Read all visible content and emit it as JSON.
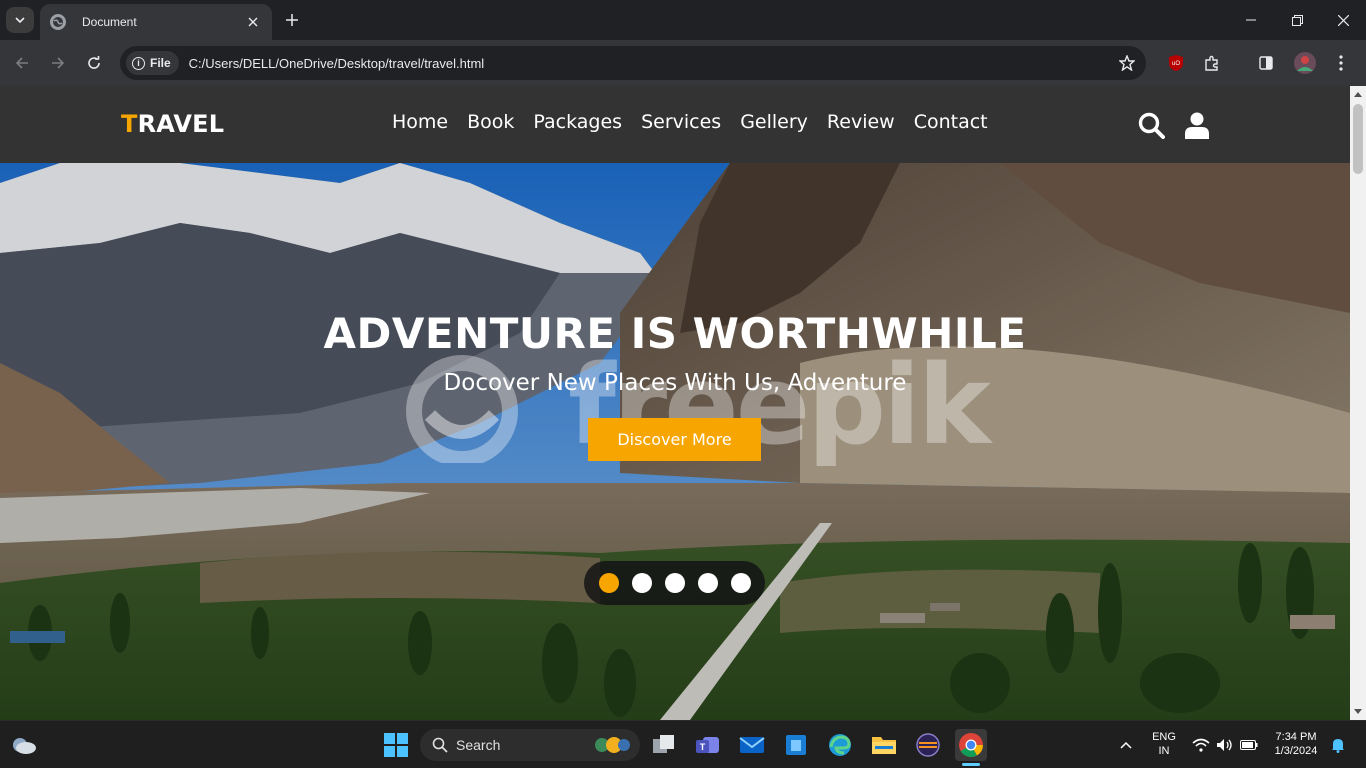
{
  "browser": {
    "tab_title": "Document",
    "url_chip": "File",
    "url": "C:/Users/DELL/OneDrive/Desktop/travel/travel.html"
  },
  "site": {
    "logo_first": "T",
    "logo_rest": "RAVEL",
    "nav": [
      "Home",
      "Book",
      "Packages",
      "Services",
      "Gellery",
      "Review",
      "Contact"
    ],
    "icons": [
      "search-icon",
      "user-icon"
    ]
  },
  "hero": {
    "title": "ADVENTURE IS WORTHWHILE",
    "subtitle": "Docover New Places With Us, Adventure",
    "cta_label": "Discover More",
    "watermark": "freepik",
    "slides_total": 5,
    "active_slide": 1
  },
  "taskbar": {
    "search_label": "Search",
    "lang_top": "ENG",
    "lang_bottom": "IN",
    "time": "7:34 PM",
    "date": "1/3/2024"
  },
  "colors": {
    "accent": "#f7a500",
    "header_bg": "#333333",
    "chrome_bg": "#35363a"
  }
}
